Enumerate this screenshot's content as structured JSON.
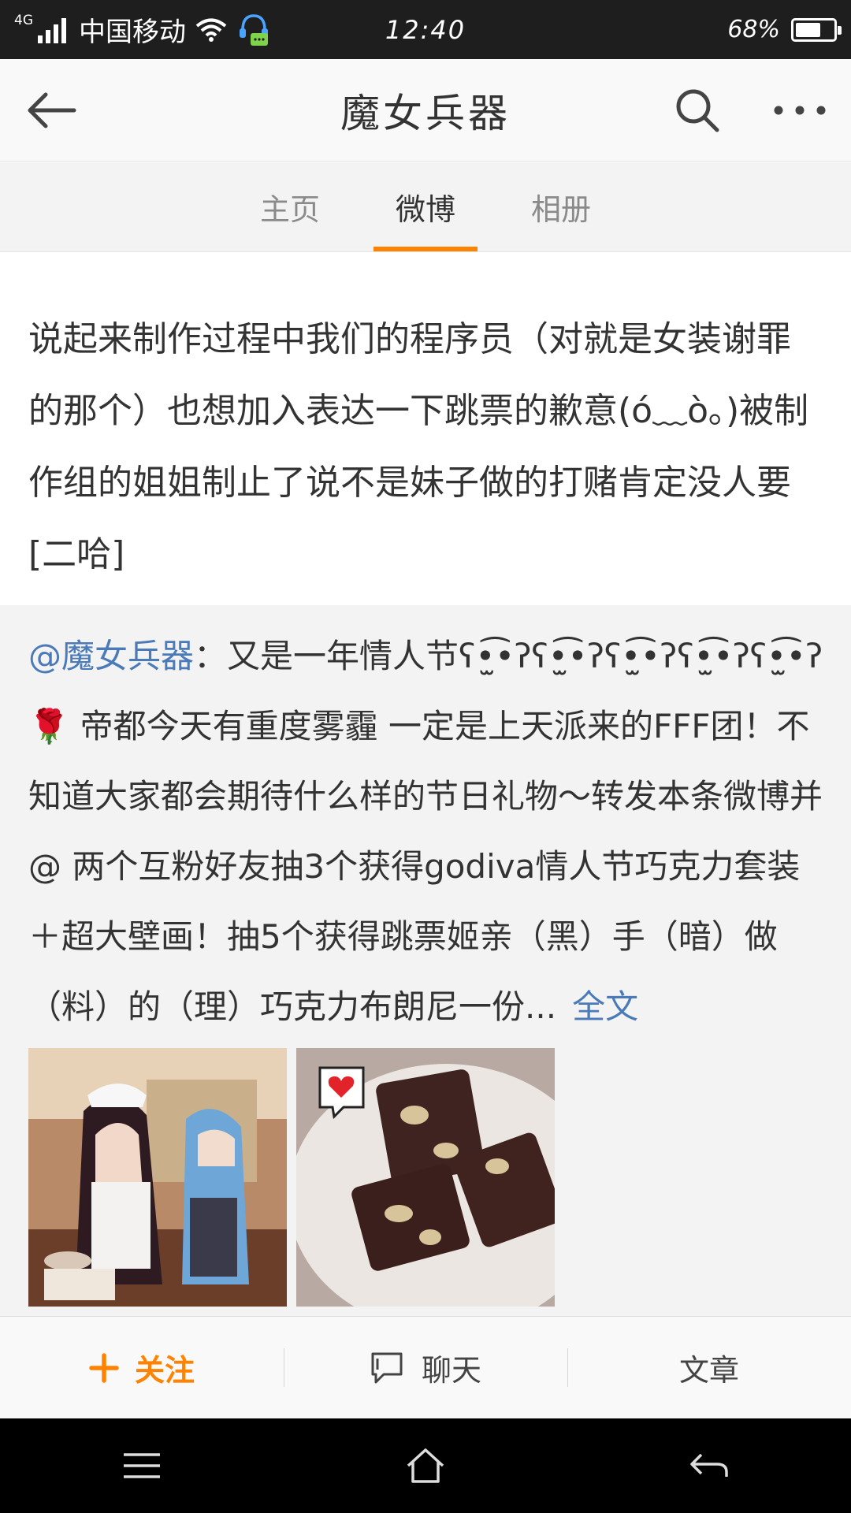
{
  "status_bar": {
    "network_type": "4G",
    "carrier": "中国移动",
    "time": "12:40",
    "battery_percent": "68%",
    "battery_level": 0.68
  },
  "header": {
    "title": "魔女兵器",
    "back_icon": "back-arrow-icon",
    "search_icon": "search-icon",
    "more_icon": "more-icon"
  },
  "tabs": [
    {
      "label": "主页",
      "active": false
    },
    {
      "label": "微博",
      "active": true
    },
    {
      "label": "相册",
      "active": false
    }
  ],
  "post": {
    "text": "说起来制作过程中我们的程序员（对就是女装谢罪的那个）也想加入表达一下跳票的歉意(ó﹏ò｡)被制作组的姐姐制止了说不是妹子做的打赌肯定没人要[二哈]"
  },
  "repost": {
    "mention": "@魔女兵器",
    "text": "：又是一年情人节ʕ•̫͡•ʔʕ•̫͡•ʔʕ•̫͡•ʔʕ•̫͡•ʔʕ•̫͡•ʔ🌹 帝都今天有重度雾霾 一定是上天派来的FFF团！不知道大家都会期待什么样的节日礼物～转发本条微博并@ 两个互粉好友抽3个获得godiva情人节巧克力套装＋超大壁画！抽5个获得跳票姬亲（黑）手（暗）做（料）的（理）巧克力布朗尼一份...",
    "full_text_link": "全文"
  },
  "actions": {
    "follow": "关注",
    "chat": "聊天",
    "articles": "文章"
  },
  "colors": {
    "accent": "#ff8200",
    "link": "#4b7ab8"
  }
}
